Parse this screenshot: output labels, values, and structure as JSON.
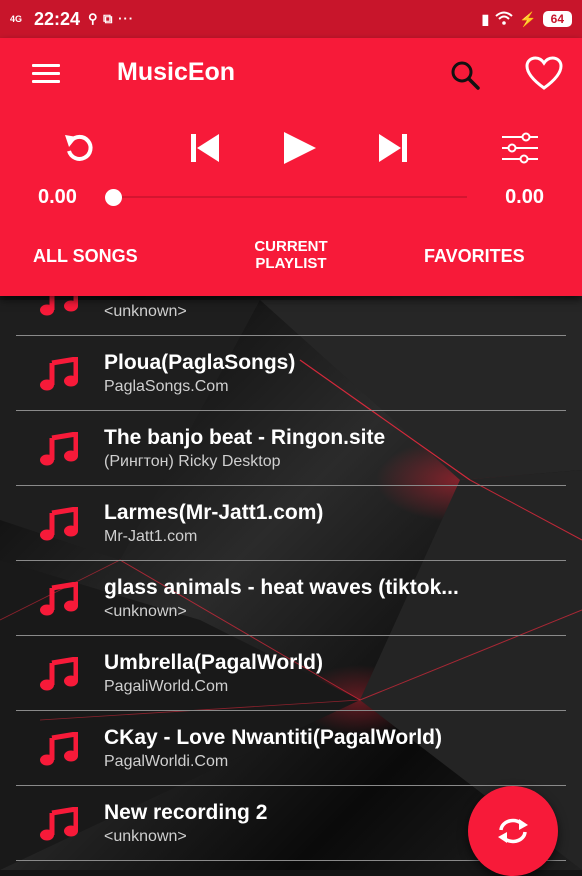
{
  "status_bar": {
    "network": "4G",
    "time": "22:24",
    "icons_text": "⚲ ⧉ ···",
    "battery": "64",
    "accent_color": "#c8152b"
  },
  "app_bar": {
    "title": "MusicEon",
    "menu_icon": "hamburger-icon",
    "search_icon": "search-icon",
    "favorite_icon": "heart-icon",
    "color": "#f71a39"
  },
  "player": {
    "current_time": "0.00",
    "total_time": "0.00",
    "progress": 0,
    "controls": [
      "repeat-icon",
      "previous-icon",
      "play-icon",
      "next-icon",
      "equalizer-icon"
    ]
  },
  "tabs": [
    {
      "label": "ALL SONGS"
    },
    {
      "label": "CURRENT PLAYLIST"
    },
    {
      "label": "FAVORITES"
    }
  ],
  "songs": [
    {
      "title": "",
      "artist": "<unknown>"
    },
    {
      "title": "Ploua(PaglaSongs)",
      "artist": "PaglaSongs.Com"
    },
    {
      "title": "The banjo beat - Ringon.site",
      "artist": "(Рингтон) Ricky Desktop"
    },
    {
      "title": "Larmes(Mr-Jatt1.com)",
      "artist": "Mr-Jatt1.com"
    },
    {
      "title": "glass animals - heat waves (tiktok...",
      "artist": "<unknown>"
    },
    {
      "title": "Umbrella(PagalWorld)",
      "artist": "PagaliWorld.Com"
    },
    {
      "title": "CKay - Love Nwantiti(PagalWorld)",
      "artist": "PagalWorldi.Com"
    },
    {
      "title": "New recording 2",
      "artist": "<unknown>"
    }
  ],
  "fab": {
    "icon": "refresh-icon"
  }
}
